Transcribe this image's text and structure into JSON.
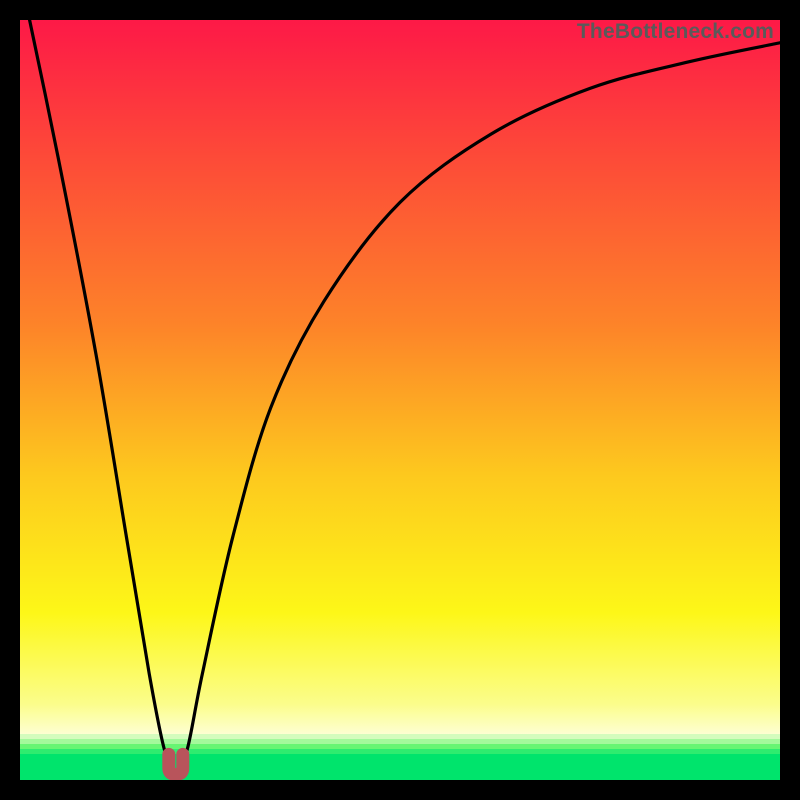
{
  "watermark": {
    "text": "TheBottleneck.com"
  },
  "colors": {
    "red_top": "#fd1947",
    "orange": "#fd8329",
    "yellow": "#fdf718",
    "pale_yellow": "#fbfd8b",
    "green_outer": "#d4fcbd",
    "green_mid": "#67f573",
    "green_inner": "#00e46c",
    "curve": "#000000",
    "marker": "#b8545b"
  },
  "chart_data": {
    "type": "line",
    "title": "",
    "xlabel": "",
    "ylabel": "",
    "xlim": [
      0,
      100
    ],
    "ylim": [
      0,
      100
    ],
    "series": [
      {
        "name": "bottleneck-curve",
        "x": [
          0,
          5,
          10,
          14,
          17,
          19,
          20.5,
          22,
          24,
          28,
          33,
          40,
          50,
          62,
          75,
          88,
          100
        ],
        "y": [
          106,
          82,
          56,
          32,
          14,
          4,
          1,
          4,
          14,
          32,
          49,
          63,
          76,
          85,
          91,
          94.5,
          97
        ]
      }
    ],
    "minimum_marker": {
      "x": 20.5,
      "y": 1
    },
    "green_threshold_y": 6
  }
}
